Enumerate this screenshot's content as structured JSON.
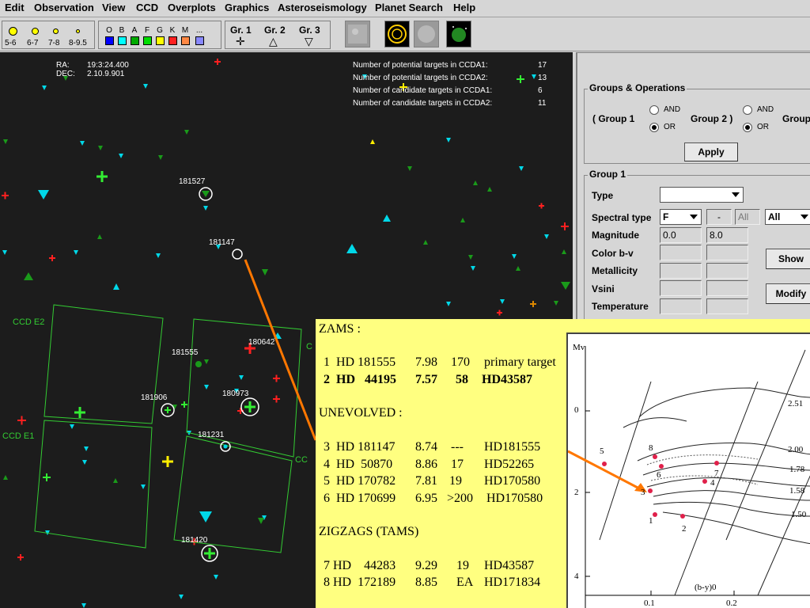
{
  "menu": [
    "Edit",
    "Observation",
    "View",
    "CCD",
    "Overplots",
    "Graphics",
    "Asteroseismology",
    "Planet Search",
    "Help"
  ],
  "toolbar": {
    "magnitudes": [
      "5-6",
      "6-7",
      "7-8",
      "8-9.5"
    ],
    "spectral_types": [
      "O",
      "B",
      "A",
      "F",
      "G",
      "K",
      "M",
      "..."
    ],
    "spectral_colors": [
      "#0000ff",
      "#00ffff",
      "#00aa00",
      "#00dd00",
      "#ffff00",
      "#ff2020",
      "#ff8844",
      "#8888ff"
    ],
    "groups": [
      {
        "label": "Gr. 1",
        "symbol": "✛"
      },
      {
        "label": "Gr. 2",
        "symbol": "△"
      },
      {
        "label": "Gr. 3",
        "symbol": "▽"
      }
    ]
  },
  "sky": {
    "coords": {
      "ra_label": "RA:",
      "ra_value": "19:3:24.400",
      "dec_label": "DEC:",
      "dec_value": "2.10.9.901"
    },
    "stats": [
      {
        "label": "Number of potential targets in CCDA1:",
        "value": "17"
      },
      {
        "label": "Number of potential targets in CCDA2:",
        "value": "13"
      },
      {
        "label": "Number of candidate targets in CCDA1:",
        "value": "6"
      },
      {
        "label": "Number of candidate targets in CCDA2:",
        "value": "11"
      }
    ],
    "star_ids": [
      "181527",
      "181147",
      "181555",
      "180642",
      "181906",
      "180973",
      "181231",
      "181420"
    ],
    "ccd_labels": [
      "CCD E2",
      "CCD E1",
      "C",
      "CC"
    ]
  },
  "panel": {
    "groups_ops": {
      "title": "Groups & Operations",
      "group1_label": "( Group 1",
      "group2_label": "Group 2 )",
      "group3_label": "Group",
      "and_label": "AND",
      "or_label": "OR",
      "apply": "Apply"
    },
    "group1": {
      "title": "Group 1",
      "type_label": "Type",
      "type_value": "",
      "spectral_label": "Spectral type",
      "spectral_from": "F",
      "spectral_dash": "-",
      "spectral_to": "All",
      "spectral_class": "All",
      "magnitude_label": "Magnitude",
      "mag_min": "0.0",
      "mag_max": "8.0",
      "color_label": "Color b-v",
      "metal_label": "Metallicity",
      "vsini_label": "Vsini",
      "temp_label": "Temperature",
      "show": "Show",
      "modify": "Modify"
    }
  },
  "notes": {
    "zams_heading": "ZAMS :",
    "zams_rows": [
      {
        "n": "1",
        "hd": "HD 181555",
        "mag": "7.98",
        "vsini": "170",
        "ref": "primary target",
        "bold": false
      },
      {
        "n": "2",
        "hd": "HD   44195",
        "mag": "7.57",
        "vsini": "58",
        "ref": "HD43587",
        "bold": true
      }
    ],
    "unevolved_heading": "UNEVOLVED :",
    "unevolved_rows": [
      {
        "n": "3",
        "hd": "HD 181147",
        "mag": "8.74",
        "vsini": "---",
        "ref": "HD181555"
      },
      {
        "n": "4",
        "hd": "HD  50870",
        "mag": "8.86",
        "vsini": "17",
        "ref": "HD52265"
      },
      {
        "n": "5",
        "hd": "HD 170782",
        "mag": "7.81",
        "vsini": "19",
        "ref": "HD170580"
      },
      {
        "n": "6",
        "hd": "HD 170699",
        "mag": "6.95",
        "vsini": ">200",
        "ref": "HD170580"
      }
    ],
    "zigzag_heading": "ZIGZAGS (TAMS)",
    "zigzag_rows": [
      {
        "n": "7",
        "hd": "HD    44283",
        "mag": "9.29",
        "vsini": "19",
        "ref": "HD43587"
      },
      {
        "n": "8",
        "hd": "HD  172189",
        "mag": "8.85",
        "vsini": "EA",
        "ref": "HD171834"
      }
    ]
  },
  "hr_diagram": {
    "y_axis_label": "Mv",
    "x_axis_label": "(b-y)0",
    "y_ticks": [
      "0",
      "2",
      "4"
    ],
    "x_ticks": [
      "0.1",
      "0.2"
    ],
    "mass_labels": [
      "2.51",
      "2.00",
      "1.78",
      "1.58",
      "1.50"
    ],
    "point_labels": [
      "1",
      "2",
      "3",
      "4",
      "5",
      "6",
      "7",
      "8"
    ]
  }
}
